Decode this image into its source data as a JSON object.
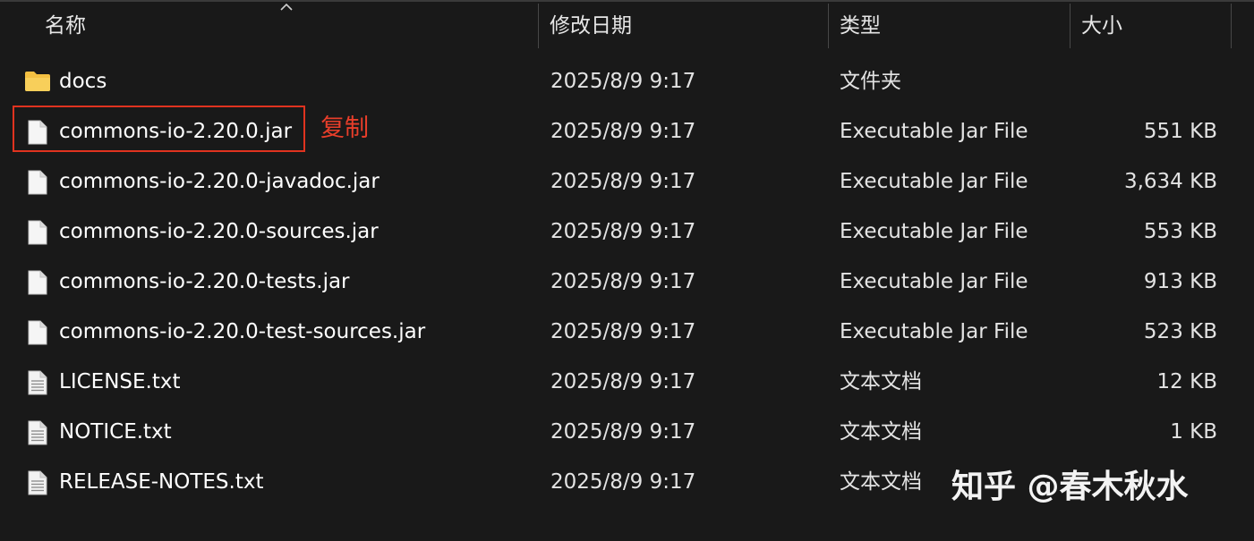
{
  "columns": {
    "name": "名称",
    "date": "修改日期",
    "type": "类型",
    "size": "大小"
  },
  "files": [
    {
      "name": "docs",
      "date": "2025/8/9 9:17",
      "type": "文件夹",
      "size": "",
      "icon": "folder-icon"
    },
    {
      "name": "commons-io-2.20.0.jar",
      "date": "2025/8/9 9:17",
      "type": "Executable Jar File",
      "size": "551 KB",
      "icon": "file-icon"
    },
    {
      "name": "commons-io-2.20.0-javadoc.jar",
      "date": "2025/8/9 9:17",
      "type": "Executable Jar File",
      "size": "3,634 KB",
      "icon": "file-icon"
    },
    {
      "name": "commons-io-2.20.0-sources.jar",
      "date": "2025/8/9 9:17",
      "type": "Executable Jar File",
      "size": "553 KB",
      "icon": "file-icon"
    },
    {
      "name": "commons-io-2.20.0-tests.jar",
      "date": "2025/8/9 9:17",
      "type": "Executable Jar File",
      "size": "913 KB",
      "icon": "file-icon"
    },
    {
      "name": "commons-io-2.20.0-test-sources.jar",
      "date": "2025/8/9 9:17",
      "type": "Executable Jar File",
      "size": "523 KB",
      "icon": "file-icon"
    },
    {
      "name": "LICENSE.txt",
      "date": "2025/8/9 9:17",
      "type": "文本文档",
      "size": "12 KB",
      "icon": "text-file-icon"
    },
    {
      "name": "NOTICE.txt",
      "date": "2025/8/9 9:17",
      "type": "文本文档",
      "size": "1 KB",
      "icon": "text-file-icon"
    },
    {
      "name": "RELEASE-NOTES.txt",
      "date": "2025/8/9 9:17",
      "type": "文本文档",
      "size": "",
      "icon": "text-file-icon"
    }
  ],
  "annotation": {
    "label": "复制",
    "color": "#e83e2a"
  },
  "watermark": "知乎 @春木秋水",
  "colors": {
    "background": "#191919",
    "folder": "#f4c042",
    "highlight": "#e0331f"
  }
}
